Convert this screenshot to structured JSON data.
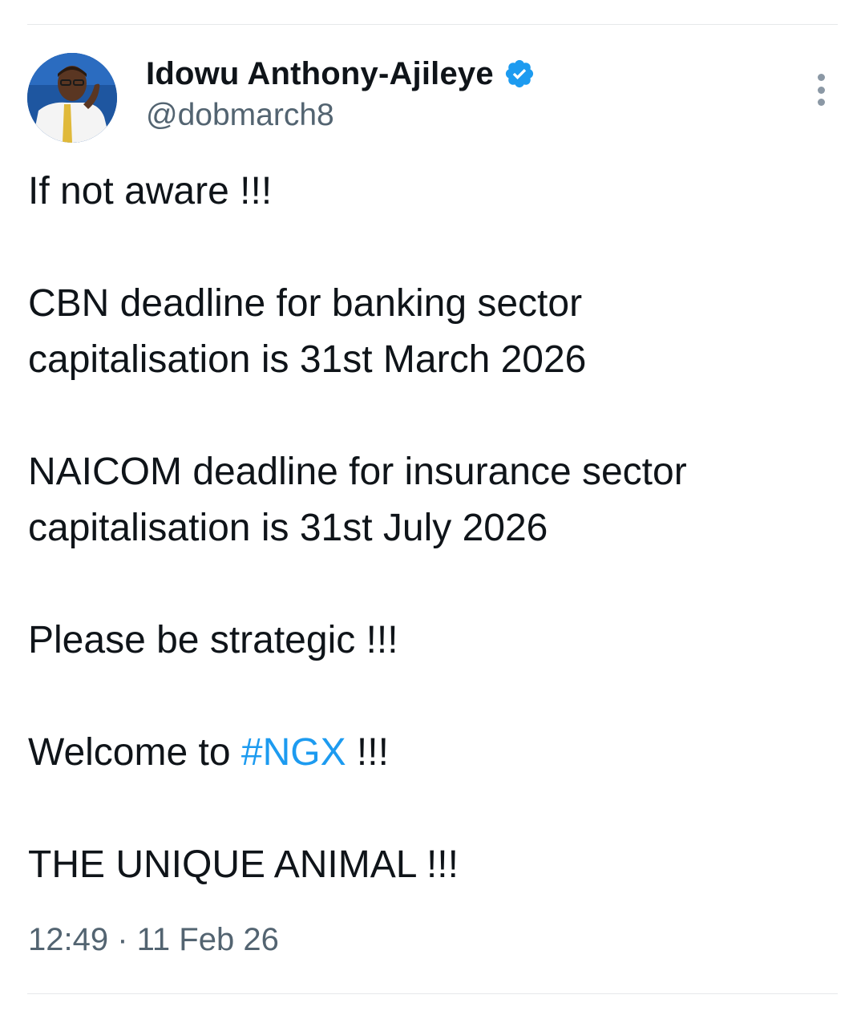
{
  "author": {
    "display_name": "Idowu Anthony-Ajileye",
    "handle": "@dobmarch8",
    "verified": true,
    "avatar_icon": "profile-photo",
    "verified_icon": "verified-badge-icon"
  },
  "menu": {
    "icon": "more-options-icon"
  },
  "tweet": {
    "line1": "If not aware !!!",
    "line2a": "CBN deadline for banking sector",
    "line2b": "capitalisation is 31st March 2026",
    "line3a": "NAICOM deadline for insurance sector",
    "line3b": "capitalisation is 31st July 2026",
    "line4": "Please be strategic !!!",
    "line5_prefix": "Welcome to ",
    "line5_hashtag": "#NGX",
    "line5_suffix": " !!!",
    "line6": "THE UNIQUE ANIMAL !!!"
  },
  "meta": {
    "time": "12:49",
    "separator": " · ",
    "date": "11 Feb 26"
  },
  "colors": {
    "text": "#0f1419",
    "secondary": "#536471",
    "link": "#1d9bf0",
    "verified": "#1d9bf0"
  }
}
